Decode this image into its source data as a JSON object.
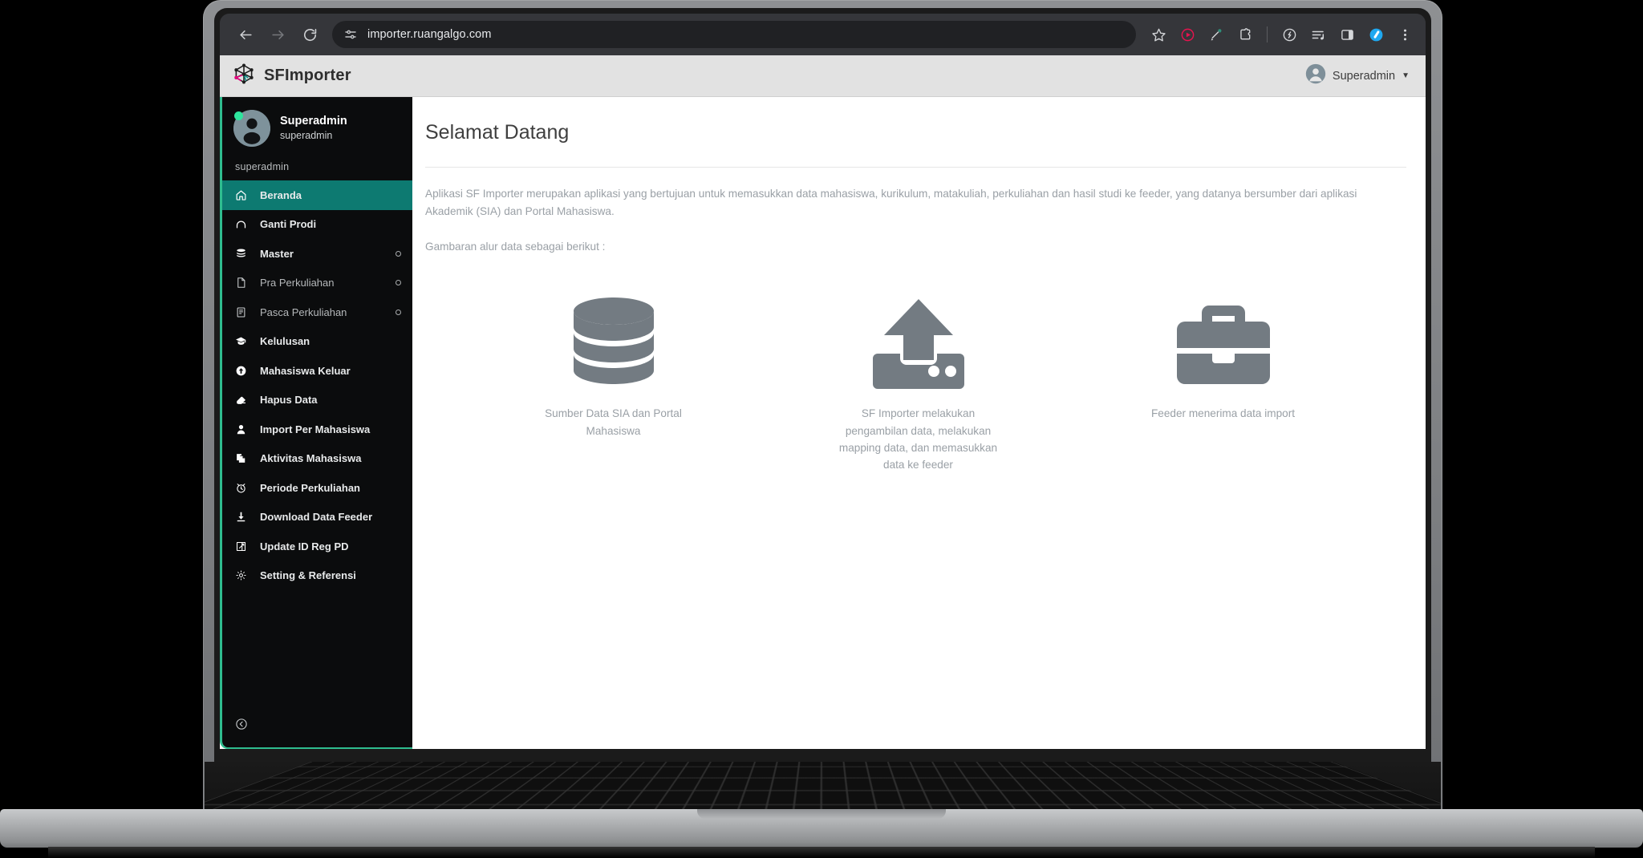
{
  "browser": {
    "back_icon": "back-arrow-icon",
    "forward_icon": "forward-arrow-icon",
    "reload_icon": "reload-icon",
    "site_settings_icon": "site-settings-icon",
    "url": "importer.ruangalgo.com",
    "bookmark_icon": "star-icon",
    "toolbar_icons": [
      "record-icon",
      "eyedropper-icon",
      "extensions-icon",
      "leaf-icon",
      "playlist-icon",
      "side-panel-icon",
      "profile-avatar-icon",
      "more-menu-icon"
    ]
  },
  "app": {
    "brand_title": "SFImporter",
    "brand_logo_icon": "network-graph-logo-icon",
    "user_menu": {
      "name": "Superadmin",
      "avatar_icon": "user-avatar-icon",
      "caret_icon": "caret-down-icon"
    }
  },
  "sidebar": {
    "profile": {
      "name": "Superadmin",
      "role": "superadmin",
      "avatar_icon": "user-avatar-icon",
      "status_dot": "online-status-dot",
      "status_color": "#2ee59d"
    },
    "section_label": "superadmin",
    "active_color": "#0d7a71",
    "accent_border_color": "#2fbd8f",
    "collapse_icon": "collapse-left-icon",
    "items": [
      {
        "label": "Beranda",
        "icon": "home-icon",
        "active": true,
        "muted": false,
        "has_submenu": false
      },
      {
        "label": "Ganti Prodi",
        "icon": "redo-arrow-icon",
        "active": false,
        "muted": false,
        "has_submenu": false
      },
      {
        "label": "Master",
        "icon": "database-icon",
        "active": false,
        "muted": false,
        "has_submenu": true
      },
      {
        "label": "Pra Perkuliahan",
        "icon": "file-icon",
        "active": false,
        "muted": true,
        "has_submenu": true
      },
      {
        "label": "Pasca Perkuliahan",
        "icon": "document-lines-icon",
        "active": false,
        "muted": true,
        "has_submenu": true
      },
      {
        "label": "Kelulusan",
        "icon": "graduation-cap-icon",
        "active": false,
        "muted": false,
        "has_submenu": false
      },
      {
        "label": "Mahasiswa Keluar",
        "icon": "arrow-up-circle-icon",
        "active": false,
        "muted": false,
        "has_submenu": false
      },
      {
        "label": "Hapus Data",
        "icon": "eraser-icon",
        "active": false,
        "muted": false,
        "has_submenu": false
      },
      {
        "label": "Import Per Mahasiswa",
        "icon": "user-solid-icon",
        "active": false,
        "muted": false,
        "has_submenu": false
      },
      {
        "label": "Aktivitas Mahasiswa",
        "icon": "copy-files-icon",
        "active": false,
        "muted": false,
        "has_submenu": false
      },
      {
        "label": "Periode Perkuliahan",
        "icon": "alarm-clock-icon",
        "active": false,
        "muted": false,
        "has_submenu": false
      },
      {
        "label": "Download Data Feeder",
        "icon": "download-icon",
        "active": false,
        "muted": false,
        "has_submenu": false
      },
      {
        "label": "Update ID Reg PD",
        "icon": "edit-square-icon",
        "active": false,
        "muted": false,
        "has_submenu": false
      },
      {
        "label": "Setting & Referensi",
        "icon": "gear-icon",
        "active": false,
        "muted": false,
        "has_submenu": false
      }
    ]
  },
  "main": {
    "page_title": "Selamat Datang",
    "intro_paragraph": "Aplikasi SF Importer merupakan aplikasi yang bertujuan untuk memasukkan data mahasiswa, kurikulum, matakuliah, perkuliahan dan hasil studi ke feeder, yang datanya bersumber dari aplikasi Akademik (SIA) dan Portal Mahasiswa.",
    "flow_intro": "Gambaran alur data sebagai berikut :",
    "flow": [
      {
        "icon": "database-cylinder-icon",
        "caption": "Sumber Data SIA dan Portal Mahasiswa"
      },
      {
        "icon": "upload-arrow-icon",
        "caption": "SF Importer melakukan pengambilan data, melakukan mapping data, dan memasukkan data ke feeder"
      },
      {
        "icon": "briefcase-icon",
        "caption": "Feeder menerima data import"
      }
    ]
  }
}
